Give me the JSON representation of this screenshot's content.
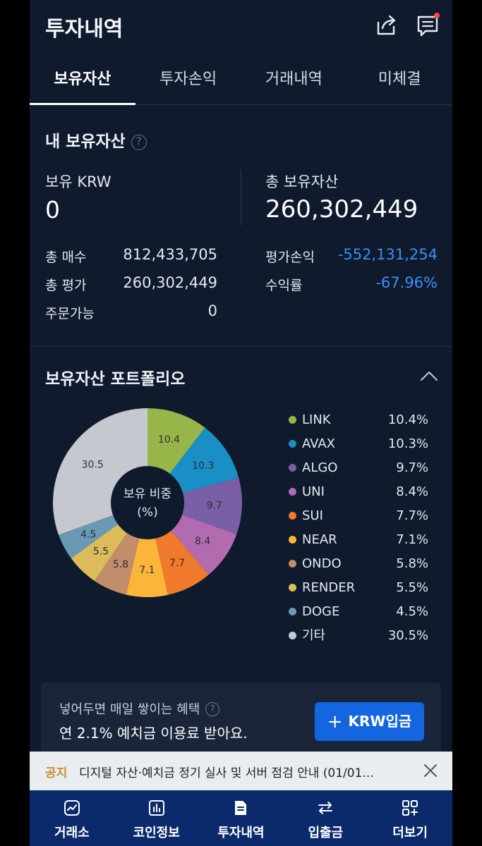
{
  "header": {
    "title": "투자내역"
  },
  "tabs": [
    "보유자산",
    "투자손익",
    "거래내역",
    "미체결"
  ],
  "summary": {
    "title": "내 보유자산",
    "help": "?",
    "krw_label": "보유 KRW",
    "krw_value": "0",
    "total_label": "총 보유자산",
    "total_value": "260,302,449",
    "rows_left": [
      {
        "label": "총 매수",
        "value": "812,433,705"
      },
      {
        "label": "총 평가",
        "value": "260,302,449"
      },
      {
        "label": "주문가능",
        "value": "0"
      }
    ],
    "rows_right": [
      {
        "label": "평가손익",
        "value": "-552,131,254"
      },
      {
        "label": "수익률",
        "value": "-67.96%"
      }
    ]
  },
  "portfolio": {
    "title": "보유자산 포트폴리오",
    "center_line1": "보유 비중",
    "center_line2": "(%)"
  },
  "chart_data": {
    "type": "pie",
    "title": "보유자산 포트폴리오",
    "categories": [
      "LINK",
      "AVAX",
      "ALGO",
      "UNI",
      "SUI",
      "NEAR",
      "ONDO",
      "RENDER",
      "DOGE",
      "기타"
    ],
    "values": [
      10.4,
      10.3,
      9.7,
      8.4,
      7.7,
      7.1,
      5.8,
      5.5,
      4.5,
      30.5
    ],
    "value_labels": [
      "10.4%",
      "10.3%",
      "9.7%",
      "8.4%",
      "7.7%",
      "7.1%",
      "5.8%",
      "5.5%",
      "4.5%",
      "30.5%"
    ],
    "colors": [
      "#98b54a",
      "#1a8fc6",
      "#7a5fa6",
      "#b36bb0",
      "#f07a2c",
      "#fbb53a",
      "#c28d6a",
      "#dcbb5a",
      "#6b98b4",
      "#c5c8ce"
    ],
    "legend_position": "right"
  },
  "promo": {
    "sub": "넣어두면 매일 쌓이는 혜택",
    "main": "연 2.1% 예치금 이용료 받아요.",
    "button_plus": "+",
    "button": "KRW입금"
  },
  "notice": {
    "tag": "공지",
    "text": "디지털 자산·예치금 정기 실사 및 서버 점검 안내 (01/01..."
  },
  "nav": [
    "거래소",
    "코인정보",
    "투자내역",
    "입출금",
    "더보기"
  ]
}
